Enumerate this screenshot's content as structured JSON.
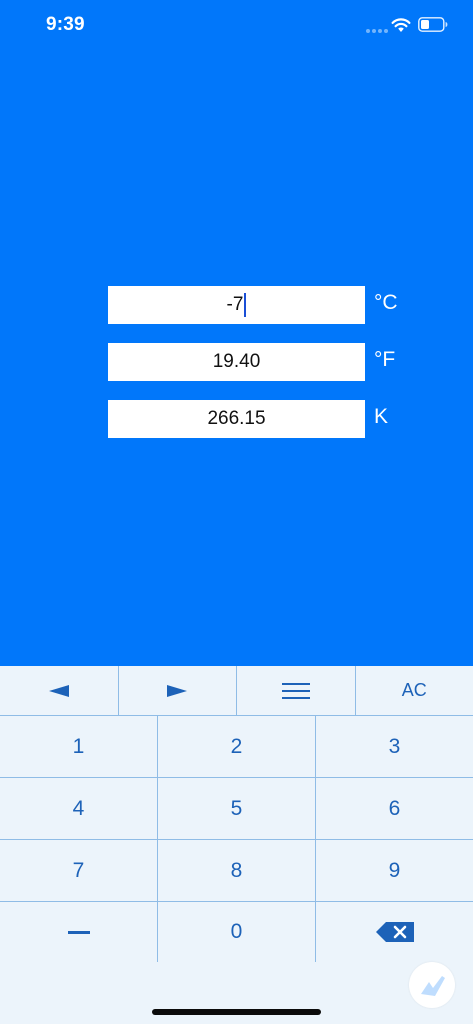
{
  "status_bar": {
    "time": "9:39",
    "icons": [
      "signal-dots-icon",
      "wifi-icon",
      "battery-icon"
    ]
  },
  "converter": {
    "celsius": {
      "value": "-7",
      "unit": "°C"
    },
    "fahrenheit": {
      "value": "19.40",
      "unit": "°F"
    },
    "kelvin": {
      "value": "266.15",
      "unit": "K"
    }
  },
  "keyboard": {
    "toolbar": {
      "left_arrow": "◀",
      "right_arrow": "▶",
      "menu": "☰",
      "clear": "AC"
    },
    "keys": [
      "1",
      "2",
      "3",
      "4",
      "5",
      "6",
      "7",
      "8",
      "9",
      "0"
    ],
    "icons": [
      "minus-icon",
      "backspace-icon"
    ]
  },
  "colors": {
    "background": "#0177fa",
    "keyboard": "#ecf4fb",
    "key_text": "#1d62b8",
    "divider": "#8fbce6"
  }
}
